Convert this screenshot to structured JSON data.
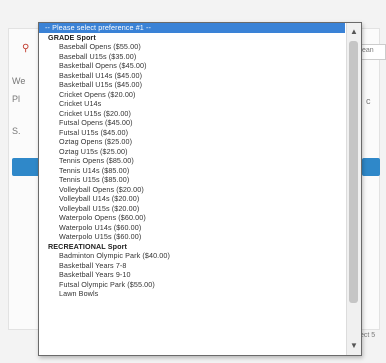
{
  "placeholder": "-- Please select preference #1 --",
  "groups": [
    {
      "label": "GRADE Sport",
      "items": [
        "Baseball Opens ($55.00)",
        "Baseball U15s ($35.00)",
        "Basketball Opens ($45.00)",
        "Basketball U14s ($45.00)",
        "Basketball U15s ($45.00)",
        "Cricket Opens ($20.00)",
        "Cricket U14s",
        "Cricket U15s ($20.00)",
        "Futsal Opens ($45.00)",
        "Futsal U15s ($45.00)",
        "Oztag Opens ($25.00)",
        "Oztag U15s ($25.00)",
        "Tennis Opens ($85.00)",
        "Tennis U14s ($85.00)",
        "Tennis U15s ($85.00)",
        "Volleyball Opens ($20.00)",
        "Volleyball U14s ($20.00)",
        "Volleyball U15s ($20.00)",
        "Waterpolo Opens ($60.00)",
        "Waterpolo U14s ($60.00)",
        "Waterpolo U15s ($60.00)"
      ]
    },
    {
      "label": "RECREATIONAL Sport",
      "items": [
        "Badminton Olympic Park ($40.00)",
        "Basketball Years 7-8",
        "Basketball Years 9-10",
        "Futsal Olympic Park ($55.00)",
        "Lawn Bowls"
      ]
    }
  ],
  "background": {
    "text_we": "We",
    "text_pl": "Pl",
    "text_s": "S.",
    "text_right": "ean",
    "text_c": "c",
    "text_bottom": "ect 5"
  },
  "scrollbar": {
    "up": "▲",
    "down": "▼",
    "position": 0.0
  }
}
